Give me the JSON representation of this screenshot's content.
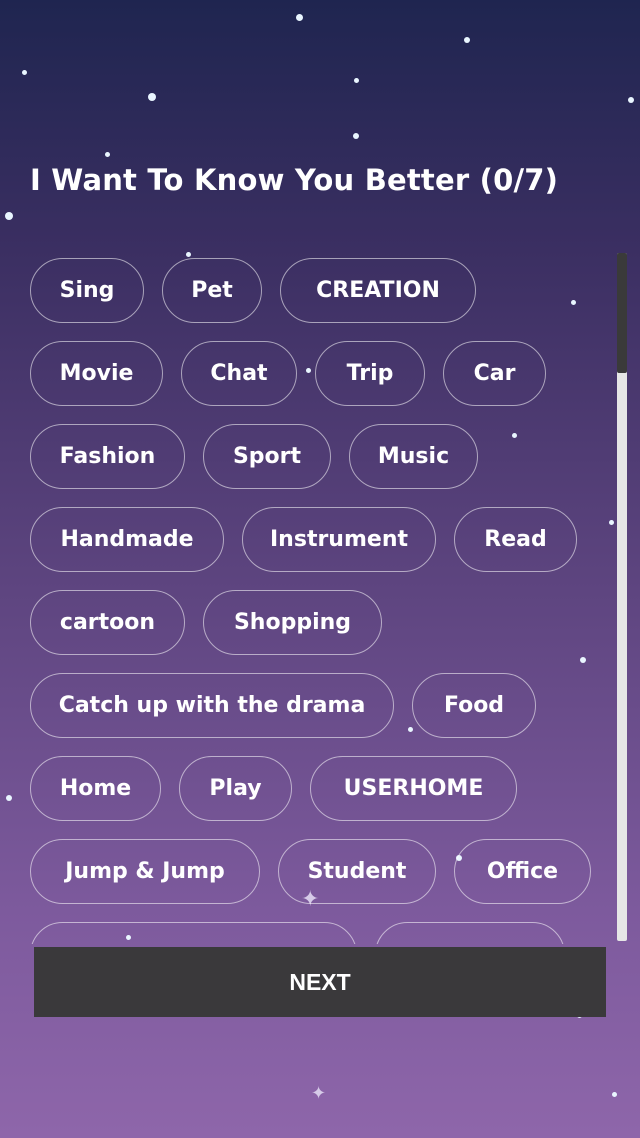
{
  "title": "I Want To Know You Better (0/7)",
  "tag_rows": [
    [
      "Sing",
      "Pet",
      "CREATION"
    ],
    [
      "Movie",
      "Chat",
      "Trip",
      "Car"
    ],
    [
      "Fashion",
      "Sport",
      "Music"
    ],
    [
      "Handmade",
      "Instrument",
      "Read"
    ],
    [
      "cartoon",
      "Shopping"
    ],
    [
      "Catch up with the drama",
      "Food"
    ],
    [
      "Home",
      "Play",
      "USERHOME"
    ],
    [
      "Jump & Jump",
      "Student",
      "Office"
    ],
    [
      "",
      ""
    ]
  ],
  "next_label": "NEXT",
  "colors": {
    "bg_top": "#1f2550",
    "bg_bottom": "#8e66aa",
    "button_bg": "#3a393b"
  }
}
